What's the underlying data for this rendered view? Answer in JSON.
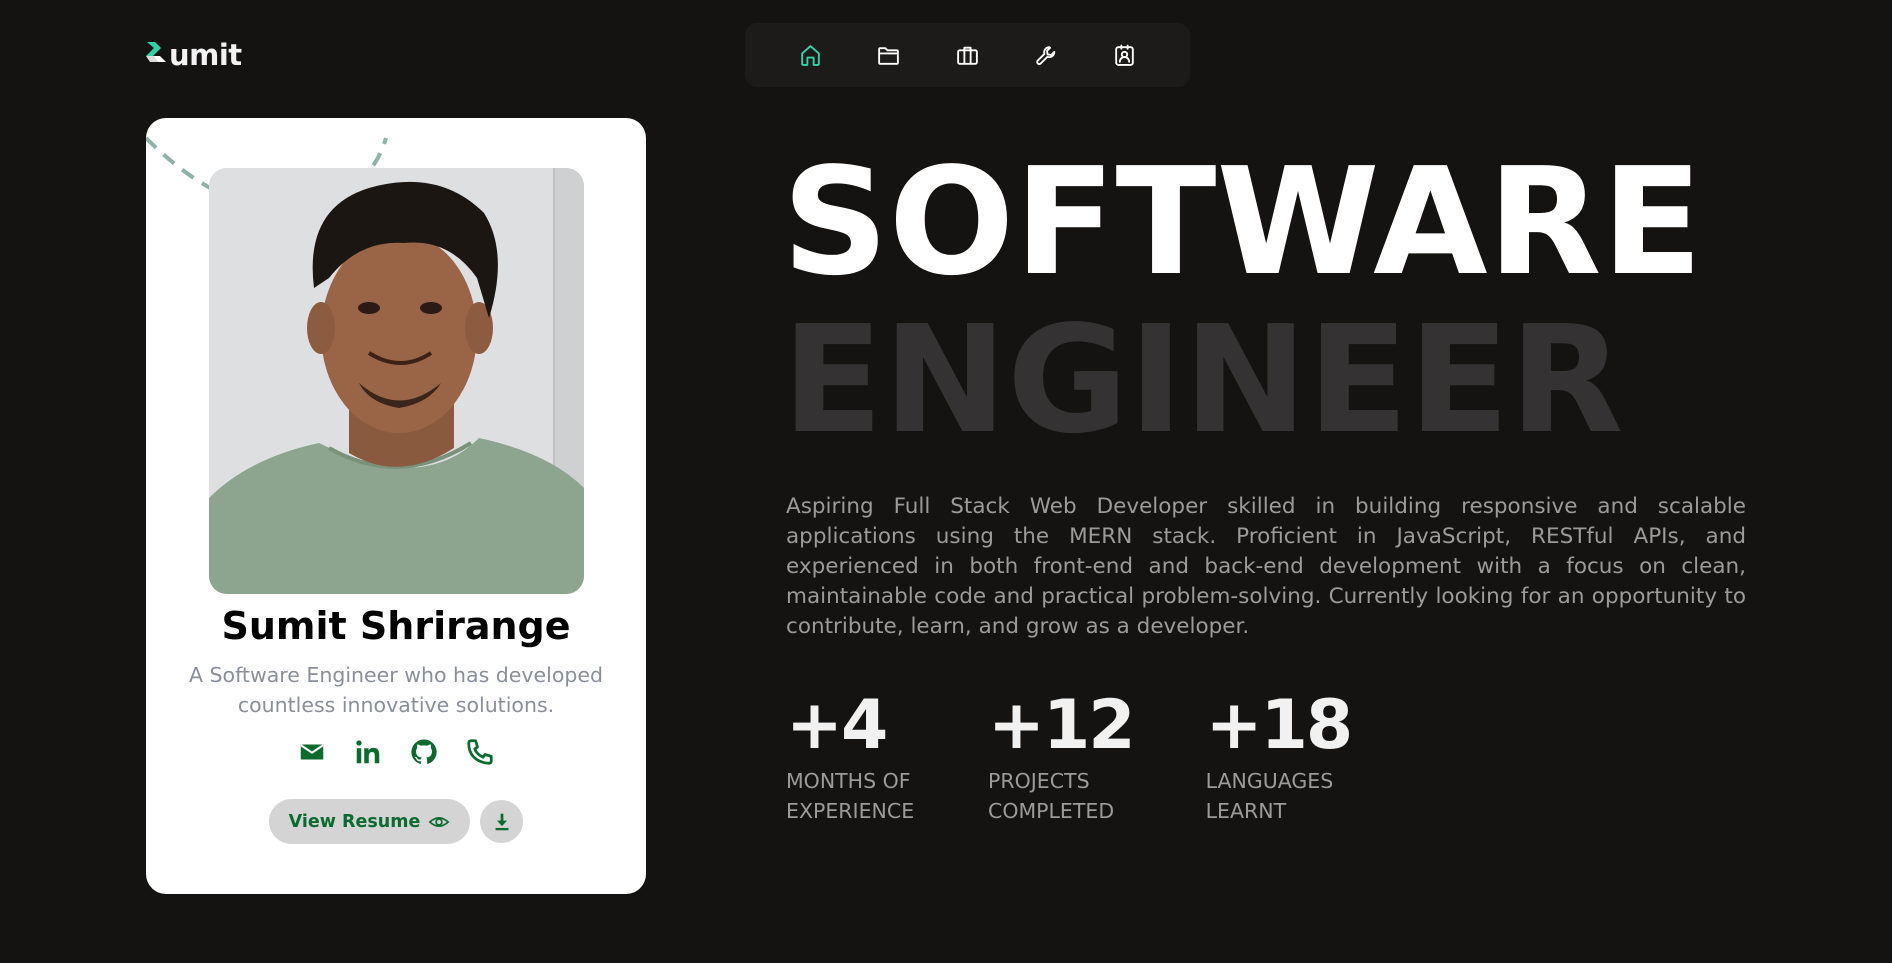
{
  "colors": {
    "background": "#141312",
    "accent": "#2ed3a8",
    "icon_green": "#0b6b2e",
    "card_bg": "#ffffff",
    "hero_secondary": "#343233"
  },
  "logo": {
    "text": "umit",
    "icon": "chevron-s-logo-icon"
  },
  "nav": {
    "items": [
      {
        "icon": "home-icon",
        "active": true
      },
      {
        "icon": "folder-icon",
        "active": false
      },
      {
        "icon": "briefcase-icon",
        "active": false
      },
      {
        "icon": "wrench-icon",
        "active": false
      },
      {
        "icon": "contact-badge-icon",
        "active": false
      }
    ]
  },
  "card": {
    "name": "Sumit Shrirange",
    "tagline": "A Software Engineer who has developed countless innovative solutions.",
    "socials": [
      {
        "icon": "email-icon"
      },
      {
        "icon": "linkedin-icon"
      },
      {
        "icon": "github-icon"
      },
      {
        "icon": "phone-icon"
      }
    ],
    "resume_label": "View Resume",
    "resume_icon": "eye-icon",
    "download_icon": "download-icon"
  },
  "hero": {
    "line1": "SOFTWARE",
    "line2": "ENGINEER",
    "description": "Aspiring Full Stack Web Developer skilled in building responsive and scalable applications using the MERN stack. Proficient in JavaScript, RESTful APIs, and experienced in both front-end and back-end development with a focus on clean, maintainable code and practical problem-solving. Currently looking for an opportunity to contribute, learn, and grow as a developer."
  },
  "stats": [
    {
      "value": "+4",
      "label": "MONTHS OF EXPERIENCE"
    },
    {
      "value": "+12",
      "label": "PROJECTS COMPLETED"
    },
    {
      "value": "+18",
      "label": "LANGUAGES LEARNT"
    }
  ]
}
